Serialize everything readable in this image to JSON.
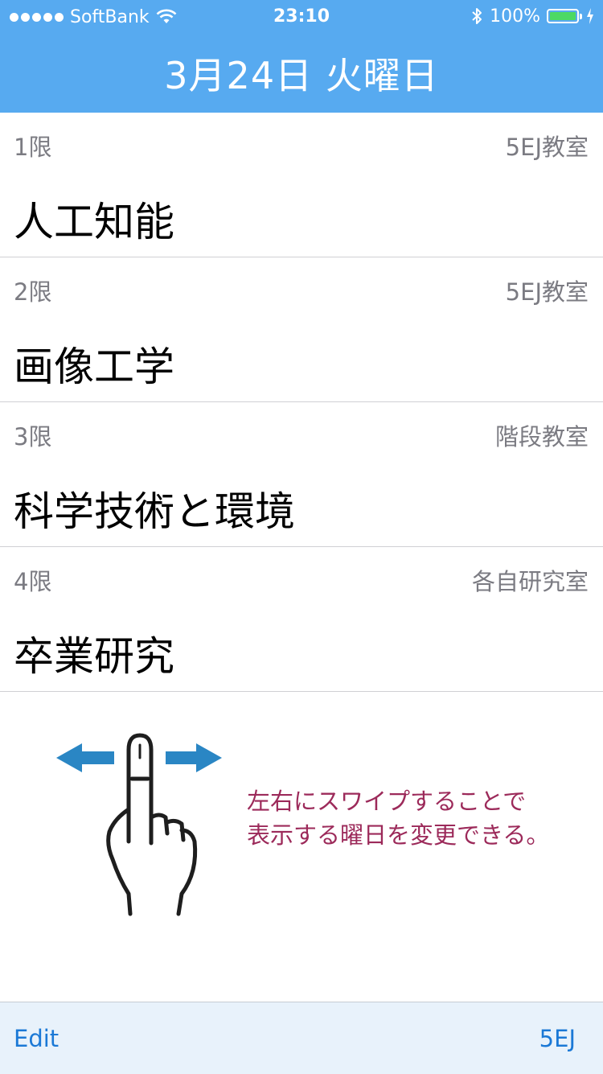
{
  "status_bar": {
    "carrier": "SoftBank",
    "time": "23:10",
    "battery_percent": "100%",
    "battery_level": 1.0,
    "battery_color": "#4cd964"
  },
  "header": {
    "title": "3月24日 火曜日",
    "background_color": "#57aaf0"
  },
  "classes": [
    {
      "period": "1限",
      "room": "5EJ教室",
      "subject": "人工知能"
    },
    {
      "period": "2限",
      "room": "5EJ教室",
      "subject": "画像工学"
    },
    {
      "period": "3限",
      "room": "階段教室",
      "subject": "科学技術と環境"
    },
    {
      "period": "4限",
      "room": "各自研究室",
      "subject": "卒業研究"
    }
  ],
  "hint": {
    "line1": "左右にスワイプすることで",
    "line2": "表示する曜日を変更できる。",
    "text_color": "#9c2a5a",
    "icons": [
      "arrow-left-icon",
      "arrow-right-icon",
      "hand-swipe-icon"
    ]
  },
  "toolbar": {
    "left_label": "Edit",
    "right_label": "5EJ",
    "tint_color": "#1b79d6"
  }
}
